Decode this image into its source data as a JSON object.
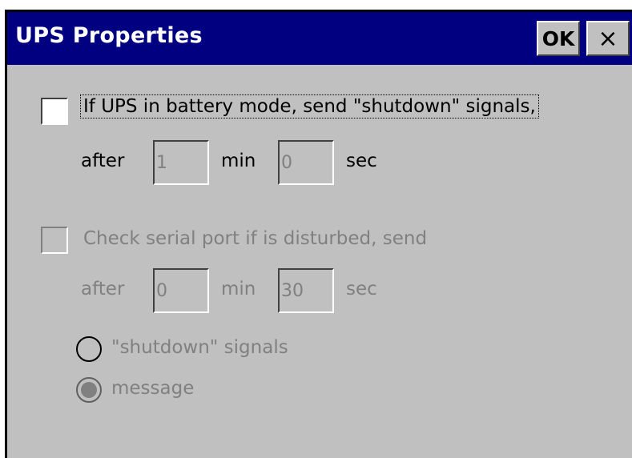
{
  "dialog": {
    "title": "UPS Properties",
    "ok_label": "OK",
    "close_glyph": "×"
  },
  "battery": {
    "checkbox_checked": false,
    "label": "If UPS in battery mode, send \"shutdown\" signals,",
    "after_label": "after",
    "min_value": "1",
    "min_label": "min",
    "sec_value": "0",
    "sec_label": "sec"
  },
  "serial": {
    "checkbox_checked": false,
    "enabled": false,
    "label": "Check serial port if is disturbed, send",
    "after_label": "after",
    "min_value": "0",
    "min_label": "min",
    "sec_value": "30",
    "sec_label": "sec",
    "options": [
      {
        "label": "\"shutdown\" signals",
        "selected": false
      },
      {
        "label": "message",
        "selected": true
      }
    ]
  }
}
